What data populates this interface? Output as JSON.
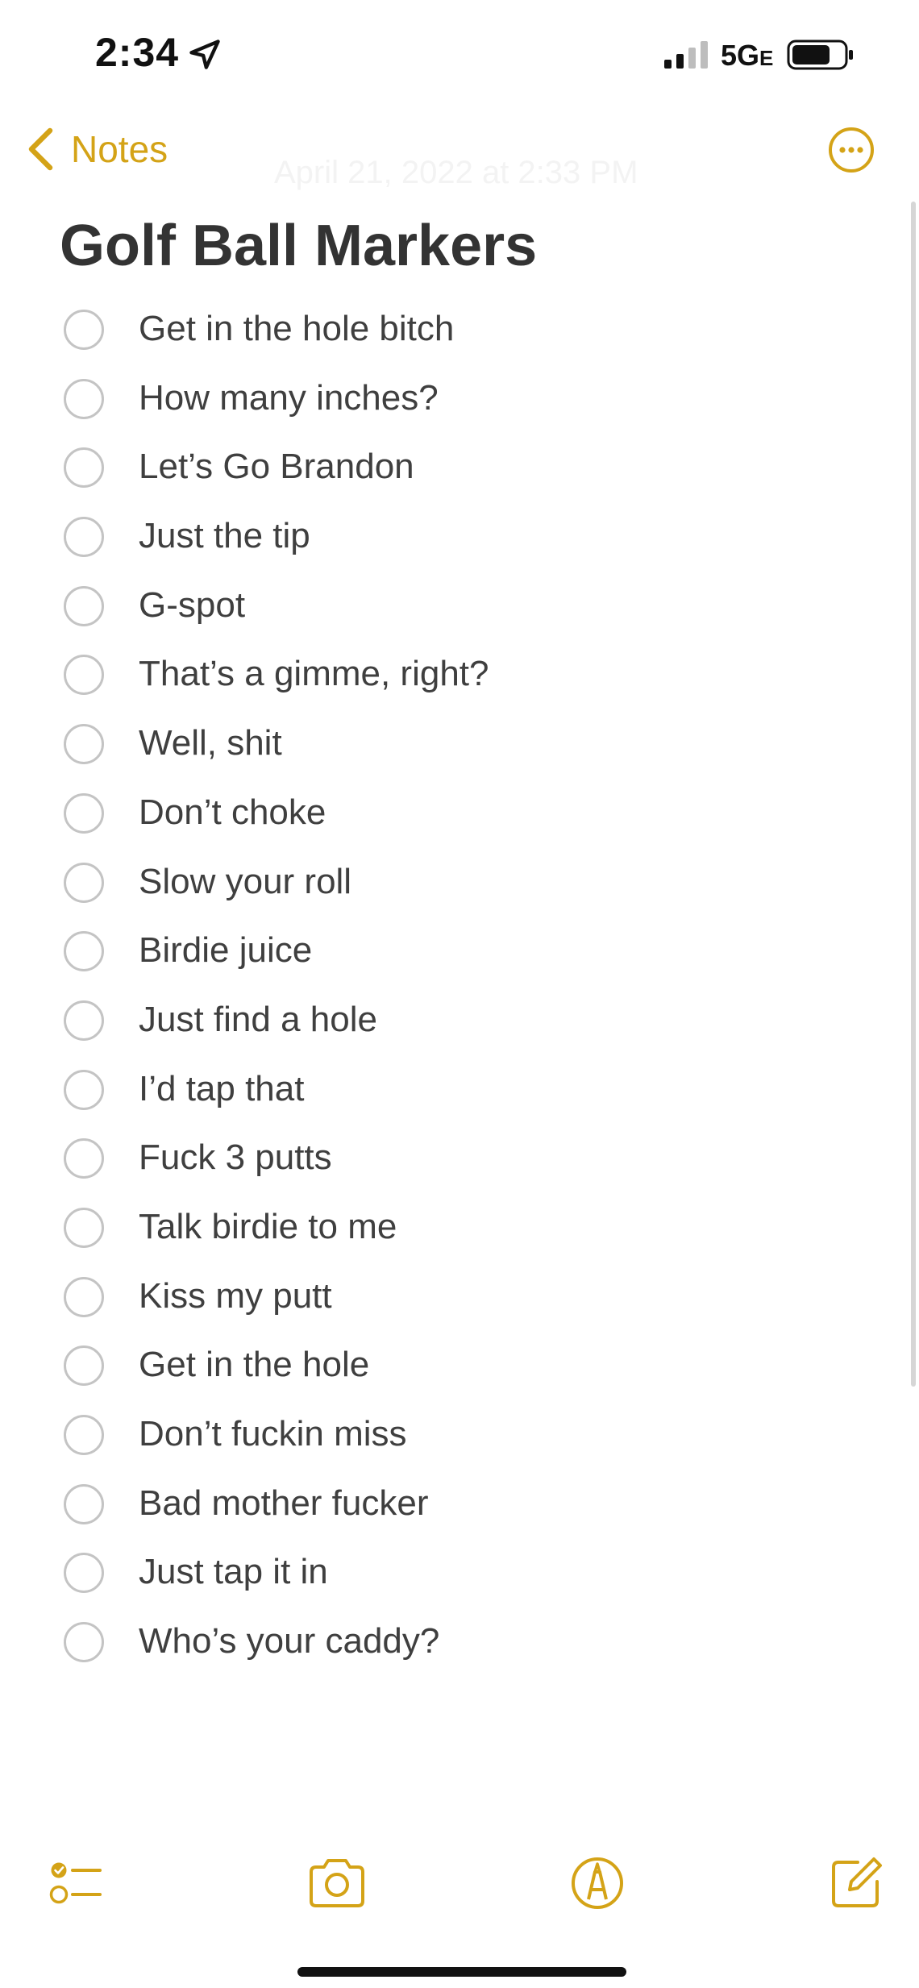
{
  "status_bar": {
    "time": "2:34",
    "network": "5G",
    "network_suffix": "E"
  },
  "nav": {
    "back_label": "Notes",
    "date_text": "April 21, 2022 at 2:33 PM"
  },
  "colors": {
    "accent": "#d4a317",
    "text": "#3f3f3f",
    "checkbox_border": "#c4c4c4"
  },
  "note": {
    "title": "Golf Ball Markers",
    "items": [
      {
        "label": "Get in the hole bitch",
        "checked": false
      },
      {
        "label": "How many inches?",
        "checked": false
      },
      {
        "label": "Let’s Go Brandon",
        "checked": false
      },
      {
        "label": "Just the tip",
        "checked": false
      },
      {
        "label": "G-spot",
        "checked": false
      },
      {
        "label": "That’s a gimme, right?",
        "checked": false
      },
      {
        "label": "Well, shit",
        "checked": false
      },
      {
        "label": "Don’t choke",
        "checked": false
      },
      {
        "label": "Slow your roll",
        "checked": false
      },
      {
        "label": "Birdie juice",
        "checked": false
      },
      {
        "label": "Just find a hole",
        "checked": false
      },
      {
        "label": "I’d tap that",
        "checked": false
      },
      {
        "label": "Fuck 3 putts",
        "checked": false
      },
      {
        "label": "Talk birdie to me",
        "checked": false
      },
      {
        "label": "Kiss my putt",
        "checked": false
      },
      {
        "label": "Get in the hole",
        "checked": false
      },
      {
        "label": "Don’t fuckin miss",
        "checked": false
      },
      {
        "label": "Bad mother fucker",
        "checked": false
      },
      {
        "label": "Just tap it in",
        "checked": false
      },
      {
        "label": "Who’s your caddy?",
        "checked": false
      }
    ]
  },
  "toolbar": {
    "icons": [
      "checklist-icon",
      "camera-icon",
      "markup-icon",
      "compose-icon"
    ]
  }
}
